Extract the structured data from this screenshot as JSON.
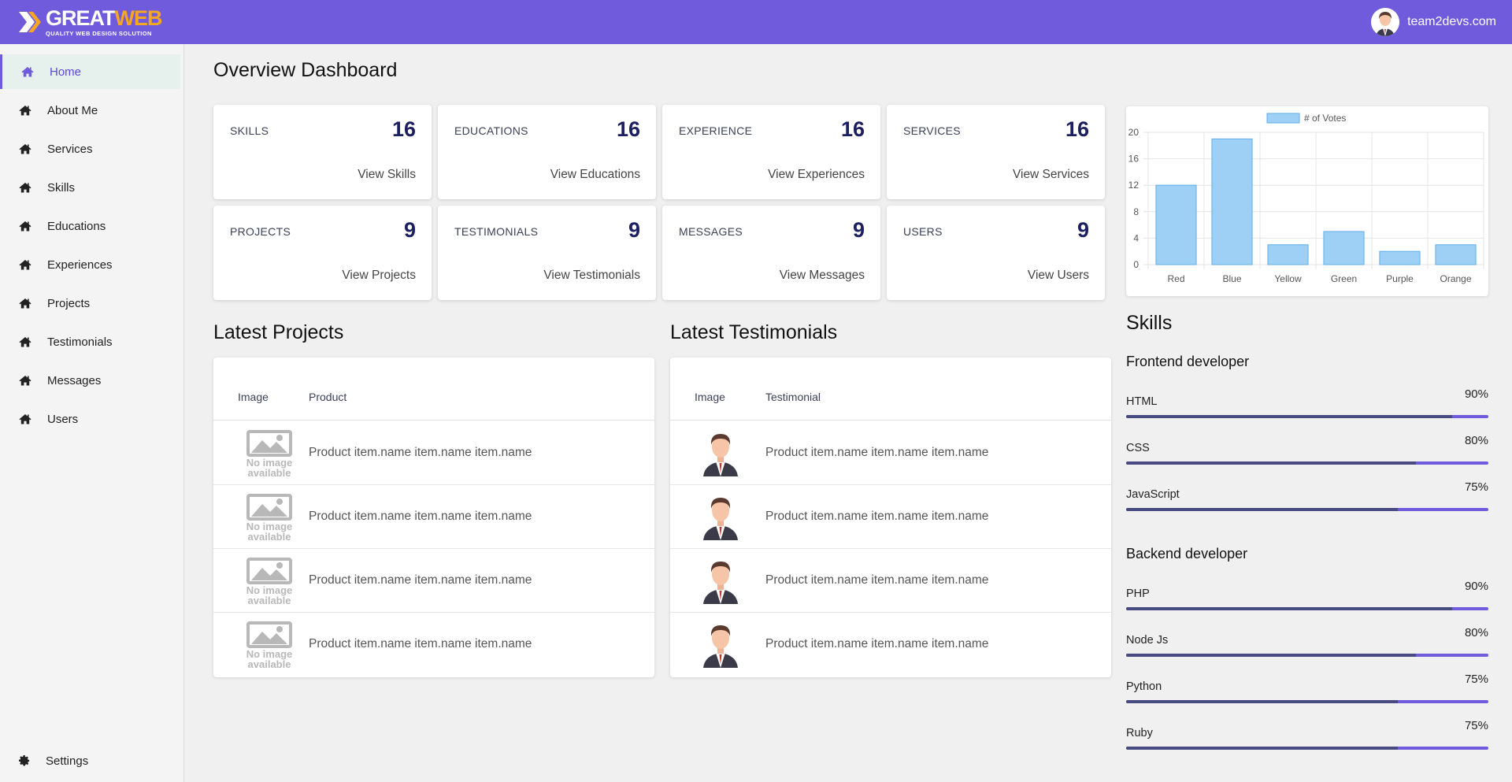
{
  "header": {
    "logo_main_a": "GREAT",
    "logo_main_b": "WEB",
    "logo_tagline": "QUALITY WEB DESIGN SOLUTION",
    "user_name": "team2devs.com"
  },
  "sidebar": {
    "items": [
      {
        "label": "Home",
        "icon": "home-icon",
        "active": true
      },
      {
        "label": "About Me",
        "icon": "home-icon"
      },
      {
        "label": "Services",
        "icon": "home-icon"
      },
      {
        "label": "Skills",
        "icon": "home-icon"
      },
      {
        "label": "Educations",
        "icon": "home-icon"
      },
      {
        "label": "Experiences",
        "icon": "home-icon"
      },
      {
        "label": "Projects",
        "icon": "home-icon"
      },
      {
        "label": "Testimonials",
        "icon": "home-icon"
      },
      {
        "label": "Messages",
        "icon": "home-icon"
      },
      {
        "label": "Users",
        "icon": "home-icon"
      }
    ],
    "settings_label": "Settings"
  },
  "page": {
    "title": "Overview Dashboard"
  },
  "stats": [
    {
      "label": "SKILLS",
      "value": "16",
      "link": "View Skills"
    },
    {
      "label": "EDUCATIONS",
      "value": "16",
      "link": "View Educations"
    },
    {
      "label": "EXPERIENCE",
      "value": "16",
      "link": "View Experiences"
    },
    {
      "label": "SERVICES",
      "value": "16",
      "link": "View Services"
    },
    {
      "label": "PROJECTS",
      "value": "9",
      "link": "View Projects"
    },
    {
      "label": "TESTIMONIALS",
      "value": "9",
      "link": "View Testimonials"
    },
    {
      "label": "MESSAGES",
      "value": "9",
      "link": "View Messages"
    },
    {
      "label": "USERS",
      "value": "9",
      "link": "View Users"
    }
  ],
  "latest_projects": {
    "title": "Latest Projects",
    "columns": [
      "Image",
      "Product"
    ],
    "noimage_line1": "No image",
    "noimage_line2": "available",
    "rows": [
      "Product item.name item.name item.name",
      "Product item.name item.name item.name",
      "Product item.name item.name item.name",
      "Product item.name item.name item.name"
    ]
  },
  "latest_testimonials": {
    "title": "Latest Testimonials",
    "columns": [
      "Image",
      "Testimonial"
    ],
    "rows": [
      "Product item.name item.name item.name",
      "Product item.name item.name item.name",
      "Product item.name item.name item.name",
      "Product item.name item.name item.name"
    ]
  },
  "chart_data": {
    "type": "bar",
    "categories": [
      "Red",
      "Blue",
      "Yellow",
      "Green",
      "Purple",
      "Orange"
    ],
    "series": [
      {
        "name": "# of Votes",
        "values": [
          12,
          19,
          3,
          5,
          2,
          3
        ]
      }
    ],
    "ylim": [
      0,
      20
    ],
    "yticks": [
      0,
      4,
      8,
      12,
      16,
      20
    ],
    "legend_position": "top",
    "grid": true,
    "colors": {
      "fill": "#9ed0f5",
      "stroke": "#5eaee8"
    }
  },
  "skills": {
    "title": "Skills",
    "groups": [
      {
        "title": "Frontend developer",
        "items": [
          {
            "name": "HTML",
            "pct_label": "90%",
            "pct": 90
          },
          {
            "name": "CSS",
            "pct_label": "80%",
            "pct": 80
          },
          {
            "name": "JavaScript",
            "pct_label": "75%",
            "pct": 75
          }
        ]
      },
      {
        "title": "Backend developer",
        "items": [
          {
            "name": "PHP",
            "pct_label": "90%",
            "pct": 90
          },
          {
            "name": "Node Js",
            "pct_label": "80%",
            "pct": 80
          },
          {
            "name": "Python",
            "pct_label": "75%",
            "pct": 75
          },
          {
            "name": "Ruby",
            "pct_label": "75%",
            "pct": 75
          }
        ]
      }
    ]
  },
  "colors": {
    "accent": "#6f5bdc",
    "stat_value": "#1d2060",
    "progress_fill": "#474b82"
  }
}
